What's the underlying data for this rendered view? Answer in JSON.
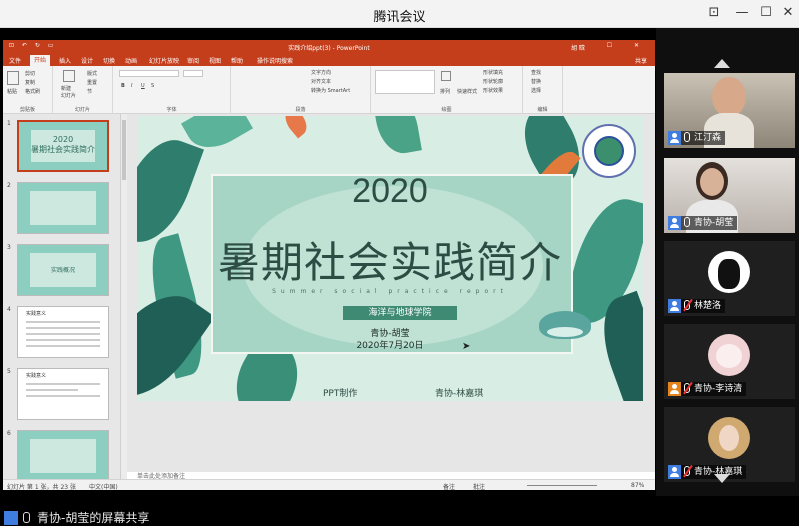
{
  "app": {
    "title": "腾讯会议",
    "window_controls": {
      "pin": "⊡",
      "minimize": "—",
      "maximize": "☐",
      "close": "✕"
    }
  },
  "powerpoint": {
    "quick_access": "⊡ ↶ ↻ ▭",
    "doc_title": "实践介绍ppt(3) - PowerPoint",
    "user": "胡 晗",
    "tabs": [
      "文件",
      "开始",
      "插入",
      "设计",
      "切换",
      "动画",
      "幻灯片放映",
      "审阅",
      "视图",
      "帮助",
      "操作说明搜索"
    ],
    "active_tab": "开始",
    "share": "共享",
    "ribbon": {
      "clipboard": {
        "paste": "粘贴",
        "cut": "剪切",
        "copy": "复制",
        "format_painter": "格式刷",
        "label": "剪贴板"
      },
      "slides": {
        "new_slide": "新建\n幻灯片",
        "layout": "版式",
        "reset": "重置",
        "section": "节",
        "label": "幻灯片"
      },
      "font": {
        "label": "字体",
        "bold": "B",
        "italic": "I",
        "underline": "U",
        "strike": "S"
      },
      "paragraph": {
        "text_direction": "文字方向",
        "align_text": "对齐文本",
        "smartart": "转换为 SmartArt",
        "label": "段落"
      },
      "drawing": {
        "arrange": "排列",
        "quick_styles": "快速样式",
        "fill": "形状填充",
        "outline": "形状轮廓",
        "effects": "形状效果",
        "label": "绘图"
      },
      "editing": {
        "find": "查找",
        "replace": "替换",
        "select": "选择",
        "label": "编辑"
      }
    },
    "thumbnails": [
      {
        "num": "1",
        "title": "2020\n暑期社会实践简介",
        "selected": true
      },
      {
        "num": "2",
        "title": "",
        "selected": false
      },
      {
        "num": "3",
        "title": "实践概况",
        "selected": false
      },
      {
        "num": "4",
        "title": "实践意义",
        "selected": false
      },
      {
        "num": "5",
        "title": "实践意义",
        "selected": false
      },
      {
        "num": "6",
        "title": "",
        "selected": false
      }
    ],
    "slide": {
      "year": "2020",
      "title": "暑期社会实践简介",
      "subtitle": "Summer social practice report",
      "school": "海洋与地球学院",
      "author": "青协-胡莹",
      "date": "2020年7月20日",
      "made_label": "PPT制作",
      "maker": "青协-林嘉琪"
    },
    "notes_placeholder": "单击此处添加备注",
    "status": {
      "slide_info": "幻灯片 第 1 张，共 23 张",
      "language": "中文(中国)",
      "notes": "备注",
      "comments": "批注",
      "zoom": "87%"
    }
  },
  "participants": [
    {
      "name": "江汀森",
      "muted": false,
      "video": true
    },
    {
      "name": "青协-胡莹",
      "muted": false,
      "video": true
    },
    {
      "name": "林楚洛",
      "muted": true,
      "video": false
    },
    {
      "name": "青协-李诗清",
      "muted": true,
      "video": false
    },
    {
      "name": "青协-林嘉琪",
      "muted": true,
      "video": false
    }
  ],
  "share_bar": {
    "text": "青协-胡莹的屏幕共享"
  }
}
